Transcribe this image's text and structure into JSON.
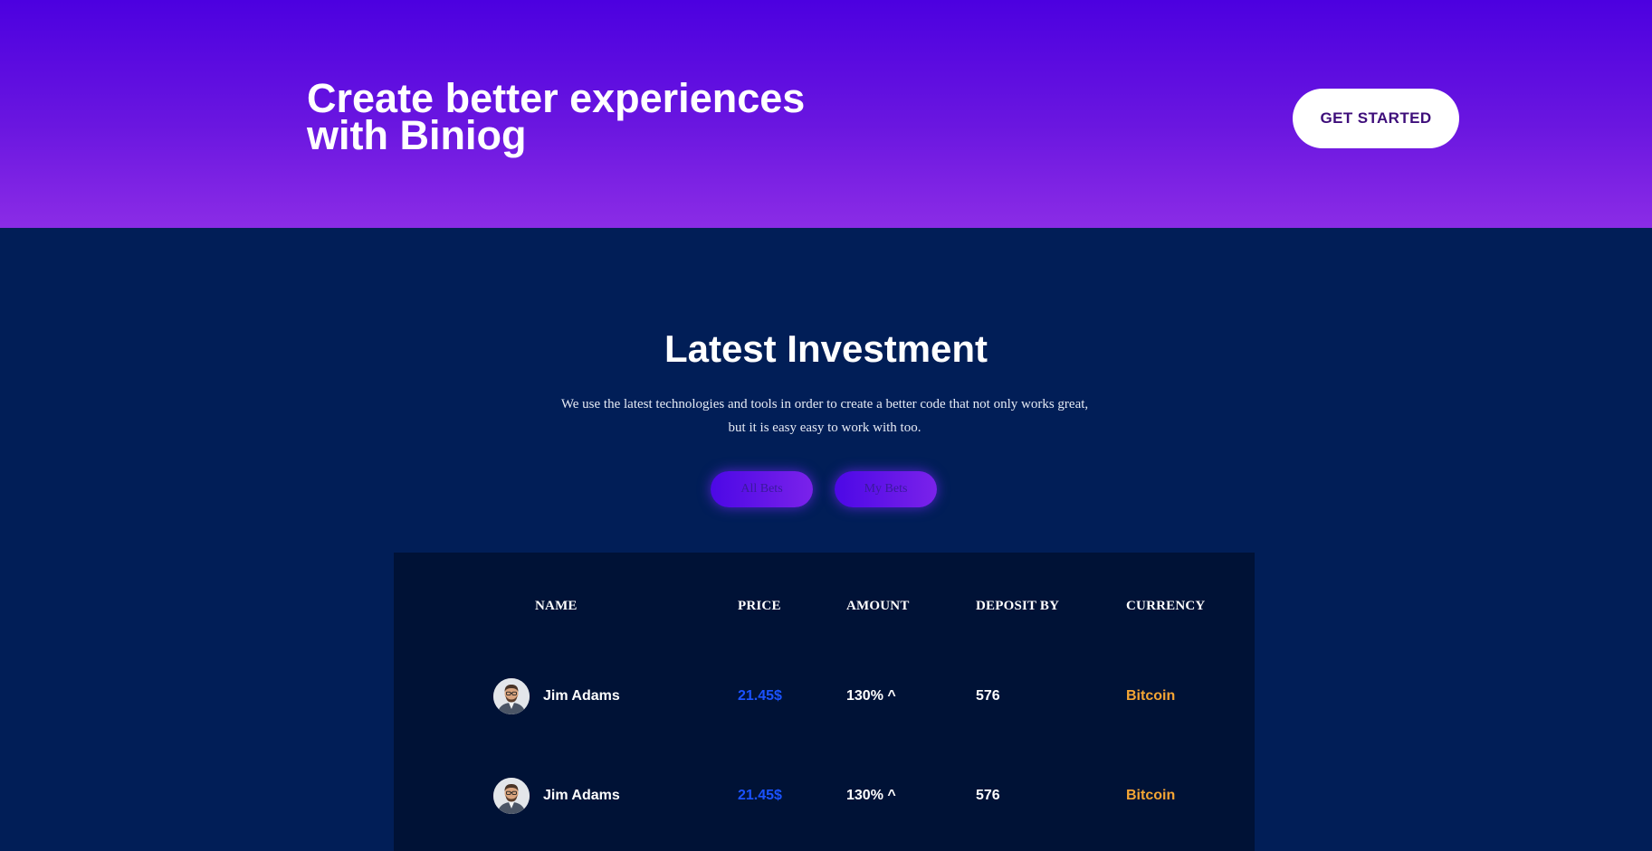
{
  "cta": {
    "title_line1": "Create better experiences",
    "title_line2": "with Biniog",
    "button_label": "GET STARTED"
  },
  "investment": {
    "title": "Latest Investment",
    "description": "We use the latest technologies and tools in order to create a better code that not only works great, but it is easy easy to work with too.",
    "tabs": [
      {
        "label": "All Bets"
      },
      {
        "label": "My Bets"
      }
    ],
    "table": {
      "headers": [
        "NAME",
        "PRICE",
        "AMOUNT",
        "DEPOSIT BY",
        "CURRENCY"
      ],
      "rows": [
        {
          "avatar": "user-avatar",
          "name": "Jim Adams",
          "price": "21.45$",
          "amount": "130% ^",
          "deposit_by": "576",
          "currency": "Bitcoin"
        },
        {
          "avatar": "user-avatar",
          "name": "Jim Adams",
          "price": "21.45$",
          "amount": "130% ^",
          "deposit_by": "576",
          "currency": "Bitcoin"
        }
      ]
    }
  },
  "colors": {
    "banner_top": "#4c00e0",
    "banner_bottom": "#8b2ce6",
    "section_background": "#011e57",
    "table_background": "#001236",
    "price": "#1a52ff",
    "currency": "#f4a534",
    "button_text": "#3d0d7a"
  }
}
